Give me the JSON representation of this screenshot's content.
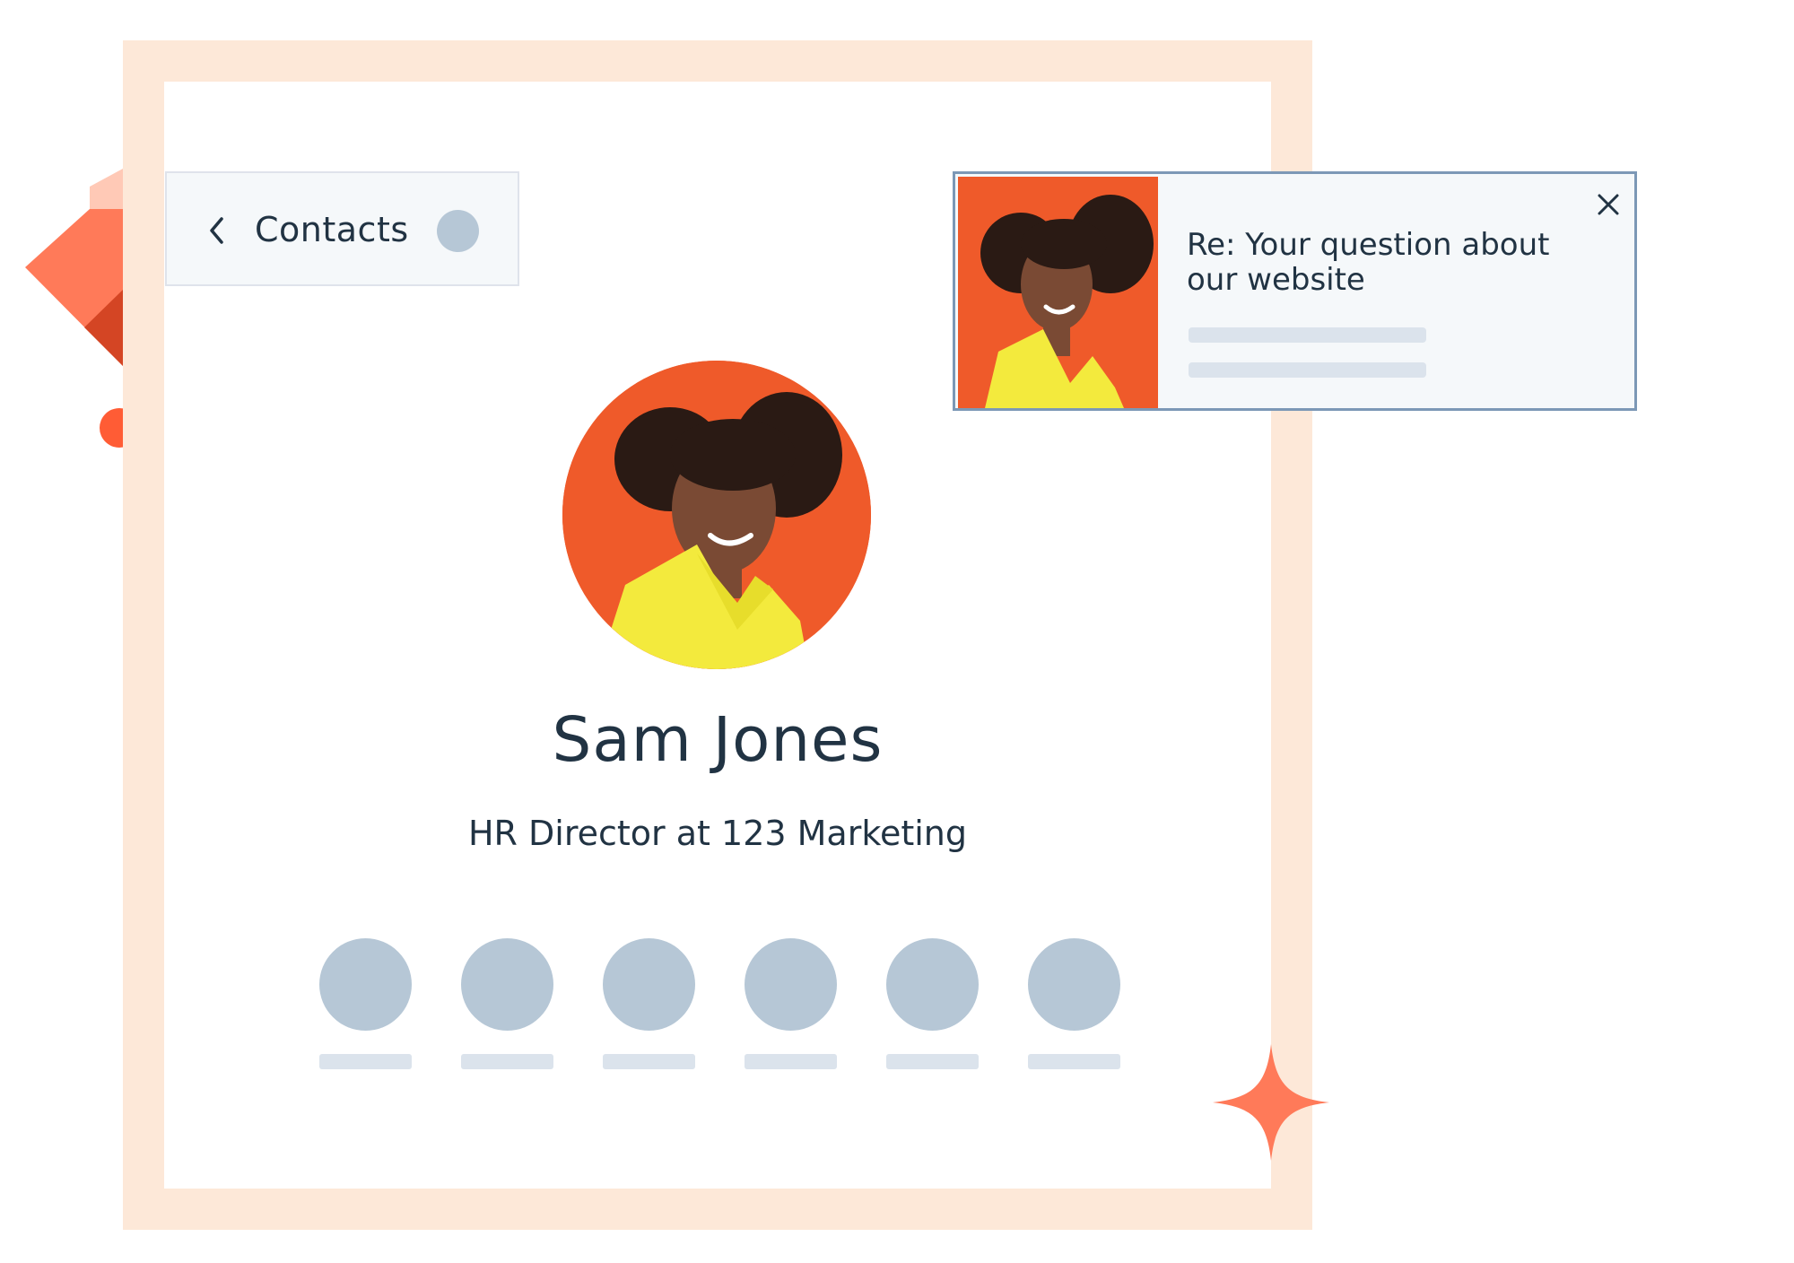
{
  "back_nav": {
    "label": "Contacts",
    "icon": "chevron-left-icon"
  },
  "contact": {
    "name": "Sam Jones",
    "subtitle": "HR Director at 123 Marketing",
    "action_count": 6
  },
  "notification": {
    "subject": "Re: Your question about our website",
    "close_icon": "close-icon"
  },
  "colors": {
    "accent": "#ff5c35",
    "frame": "#fde8d8",
    "placeholder": "#b6c7d6",
    "placeholder_bar": "#dbe3ec",
    "text": "#213343",
    "notification_border": "#7c98b6"
  }
}
